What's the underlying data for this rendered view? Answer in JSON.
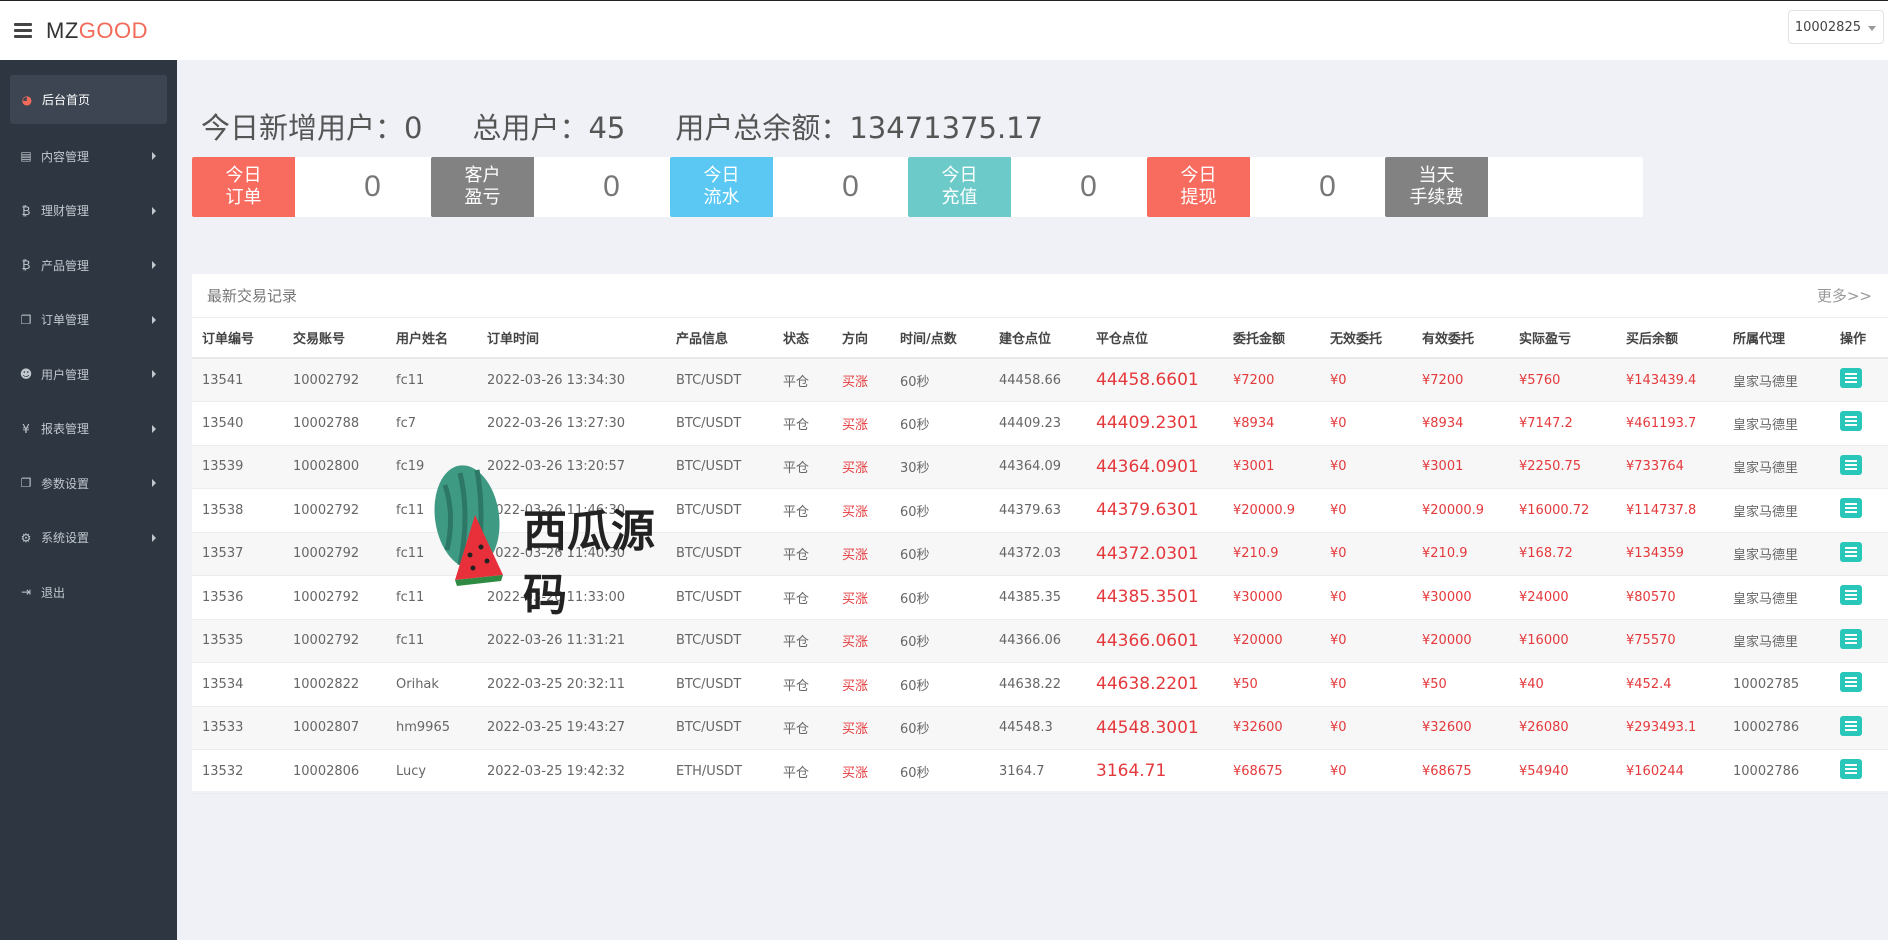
{
  "header": {
    "brand_left": "MZ",
    "brand_right": "GOOD",
    "user_id": "10002825"
  },
  "sidebar": {
    "items": [
      {
        "label": "后台首页",
        "icon": "dashboard-icon",
        "glyph": "◕"
      },
      {
        "label": "内容管理",
        "icon": "book-icon",
        "glyph": "▤"
      },
      {
        "label": "理财管理",
        "icon": "bitcoin-icon",
        "glyph": "₿"
      },
      {
        "label": "产品管理",
        "icon": "bitcoin-icon",
        "glyph": "₿"
      },
      {
        "label": "订单管理",
        "icon": "copy-icon",
        "glyph": "❐"
      },
      {
        "label": "用户管理",
        "icon": "user-icon",
        "glyph": "☻"
      },
      {
        "label": "报表管理",
        "icon": "yen-icon",
        "glyph": "¥"
      },
      {
        "label": "参数设置",
        "icon": "copy-icon",
        "glyph": "❐"
      },
      {
        "label": "系统设置",
        "icon": "cogs-icon",
        "glyph": "⚙"
      },
      {
        "label": "退出",
        "icon": "sign-out-icon",
        "glyph": "⇥"
      }
    ]
  },
  "summary": {
    "new_users": "今日新增用户：0",
    "total_users": "总用户：45",
    "total_balance": "用户总余额：13471375.17"
  },
  "stats": [
    {
      "label1": "今日",
      "label2": "订单",
      "value": "0",
      "color": "#f86c5f"
    },
    {
      "label1": "客户",
      "label2": "盈亏",
      "value": "0",
      "color": "#828282"
    },
    {
      "label1": "今日",
      "label2": "流水",
      "value": "0",
      "color": "#5ac8f2"
    },
    {
      "label1": "今日",
      "label2": "充值",
      "value": "0",
      "color": "#6ccac8"
    },
    {
      "label1": "今日",
      "label2": "提现",
      "value": "0",
      "color": "#f86c5f"
    },
    {
      "label1": "当天",
      "label2": "手续费",
      "value": "",
      "color": "#828282"
    }
  ],
  "panel": {
    "title": "最新交易记录",
    "more": "更多>>"
  },
  "table": {
    "columns": [
      "订单编号",
      "交易账号",
      "用户姓名",
      "订单时间",
      "产品信息",
      "状态",
      "方向",
      "时间/点数",
      "建仓点位",
      "平仓点位",
      "委托金额",
      "无效委托",
      "有效委托",
      "实际盈亏",
      "买后余额",
      "所属代理",
      "操作"
    ],
    "rows": [
      [
        "13541",
        "10002792",
        "fc11",
        "2022-03-26 13:34:30",
        "BTC/USDT",
        "平仓",
        "买涨",
        "60秒",
        "44458.66",
        "44458.6601",
        "¥7200",
        "¥0",
        "¥7200",
        "¥5760",
        "¥143439.4",
        "皇家马德里"
      ],
      [
        "13540",
        "10002788",
        "fc7",
        "2022-03-26 13:27:30",
        "BTC/USDT",
        "平仓",
        "买涨",
        "60秒",
        "44409.23",
        "44409.2301",
        "¥8934",
        "¥0",
        "¥8934",
        "¥7147.2",
        "¥461193.7",
        "皇家马德里"
      ],
      [
        "13539",
        "10002800",
        "fc19",
        "2022-03-26 13:20:57",
        "BTC/USDT",
        "平仓",
        "买涨",
        "30秒",
        "44364.09",
        "44364.0901",
        "¥3001",
        "¥0",
        "¥3001",
        "¥2250.75",
        "¥733764",
        "皇家马德里"
      ],
      [
        "13538",
        "10002792",
        "fc11",
        "2022-03-26 11:46:30",
        "BTC/USDT",
        "平仓",
        "买涨",
        "60秒",
        "44379.63",
        "44379.6301",
        "¥20000.9",
        "¥0",
        "¥20000.9",
        "¥16000.72",
        "¥114737.8",
        "皇家马德里"
      ],
      [
        "13537",
        "10002792",
        "fc11",
        "2022-03-26 11:40:30",
        "BTC/USDT",
        "平仓",
        "买涨",
        "60秒",
        "44372.03",
        "44372.0301",
        "¥210.9",
        "¥0",
        "¥210.9",
        "¥168.72",
        "¥134359",
        "皇家马德里"
      ],
      [
        "13536",
        "10002792",
        "fc11",
        "2022-03-26 11:33:00",
        "BTC/USDT",
        "平仓",
        "买涨",
        "60秒",
        "44385.35",
        "44385.3501",
        "¥30000",
        "¥0",
        "¥30000",
        "¥24000",
        "¥80570",
        "皇家马德里"
      ],
      [
        "13535",
        "10002792",
        "fc11",
        "2022-03-26 11:31:21",
        "BTC/USDT",
        "平仓",
        "买涨",
        "60秒",
        "44366.06",
        "44366.0601",
        "¥20000",
        "¥0",
        "¥20000",
        "¥16000",
        "¥75570",
        "皇家马德里"
      ],
      [
        "13534",
        "10002822",
        "Orihak",
        "2022-03-25 20:32:11",
        "BTC/USDT",
        "平仓",
        "买涨",
        "60秒",
        "44638.22",
        "44638.2201",
        "¥50",
        "¥0",
        "¥50",
        "¥40",
        "¥452.4",
        "10002785"
      ],
      [
        "13533",
        "10002807",
        "hm9965",
        "2022-03-25 19:43:27",
        "BTC/USDT",
        "平仓",
        "买涨",
        "60秒",
        "44548.3",
        "44548.3001",
        "¥32600",
        "¥0",
        "¥32600",
        "¥26080",
        "¥293493.1",
        "10002786"
      ],
      [
        "13532",
        "10002806",
        "Lucy",
        "2022-03-25 19:42:32",
        "ETH/USDT",
        "平仓",
        "买涨",
        "60秒",
        "3164.7",
        "3164.71",
        "¥68675",
        "¥0",
        "¥68675",
        "¥54940",
        "¥160244",
        "10002786"
      ]
    ]
  },
  "watermark": {
    "text": "西瓜源码"
  },
  "colors": {
    "accent": "#f36a5a",
    "sidebar_bg": "#2e3641",
    "red_text": "#e4393c",
    "op_button": "#29c6ba"
  }
}
